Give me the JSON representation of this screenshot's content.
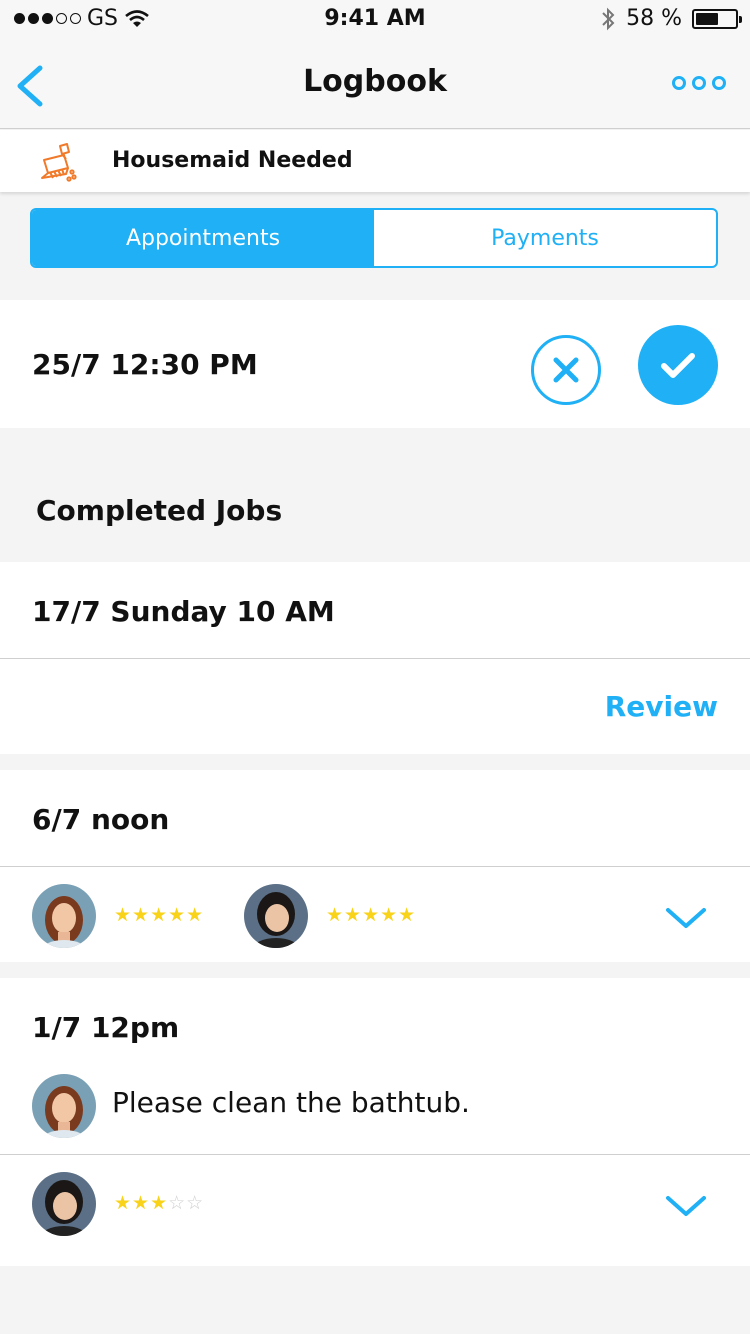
{
  "status_bar": {
    "carrier": "GS",
    "time": "9:41 AM",
    "battery": "58 %",
    "battery_level": 0.58
  },
  "nav": {
    "title": "Logbook",
    "back_icon": "chevron-left-icon",
    "more_icon": "more-icon"
  },
  "job": {
    "title": "Housemaid Needed",
    "icon": "broom-icon"
  },
  "tabs": [
    {
      "label": "Appointments",
      "active": true
    },
    {
      "label": "Payments",
      "active": false
    }
  ],
  "pending": {
    "datetime": "25/7 12:30 PM"
  },
  "completed": {
    "title": "Completed Jobs",
    "jobs": [
      {
        "datetime": "17/7 Sunday 10 AM",
        "action": "Review"
      },
      {
        "datetime": "6/7 noon",
        "ratings": [
          5,
          5
        ]
      },
      {
        "datetime": "1/7 12pm",
        "note": "Please clean the bathtub.",
        "rating": 3
      }
    ]
  },
  "colors": {
    "accent": "#1fb0f5",
    "star": "#f8d31a",
    "broom": "#f07a2a"
  }
}
